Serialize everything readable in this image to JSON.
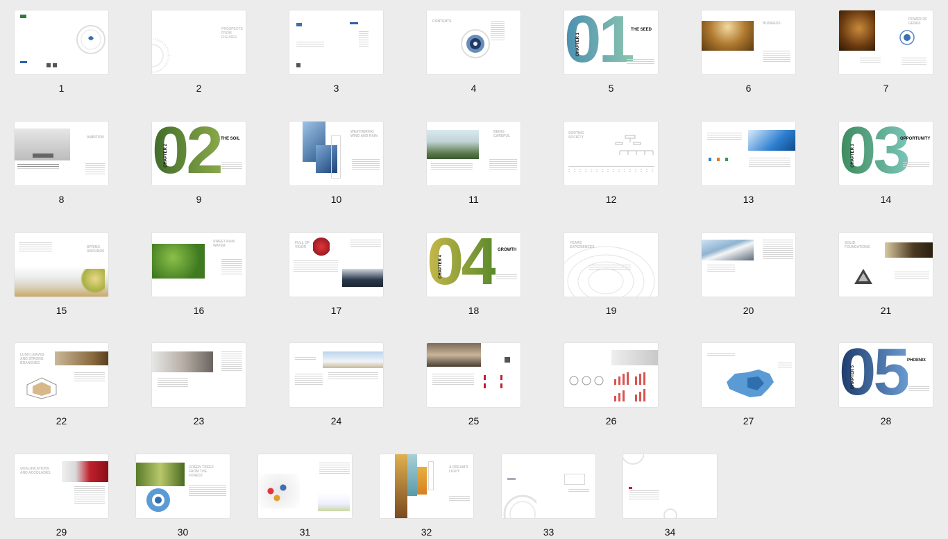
{
  "pages": [
    {
      "n": "1"
    },
    {
      "n": "2",
      "title": "PROSPECTS FROM FIGURES"
    },
    {
      "n": "3"
    },
    {
      "n": "4",
      "title": "CONTENTS"
    },
    {
      "n": "5",
      "chapter": "CHAPTER 1",
      "title": "THE SEED",
      "big": "01"
    },
    {
      "n": "6",
      "title": "BUSINESS"
    },
    {
      "n": "7",
      "title": "POWER OF GENES"
    },
    {
      "n": "8",
      "title": "AMBITION"
    },
    {
      "n": "9",
      "chapter": "CHAPTER 2",
      "title": "THE SOIL",
      "big": "02"
    },
    {
      "n": "10",
      "title": "WEATHERING WIND AND RAIN"
    },
    {
      "n": "11",
      "title": "BEING CAREFUL"
    },
    {
      "n": "12",
      "title": "SORTING SOCIETY"
    },
    {
      "n": "13"
    },
    {
      "n": "14",
      "chapter": "CHAPTER 3",
      "title": "OPPORTUNITY",
      "big": "03"
    },
    {
      "n": "15",
      "title": "SPRING ABOUNDS"
    },
    {
      "n": "16",
      "title": "SWEET RAIN WATER"
    },
    {
      "n": "17",
      "title": "FULL OF VIGOR"
    },
    {
      "n": "18",
      "chapter": "CHAPTER 4",
      "title": "GROWTH",
      "big": "04"
    },
    {
      "n": "19",
      "title": "YEARS EXPERIENCES"
    },
    {
      "n": "20"
    },
    {
      "n": "21",
      "title": "SOLID FOUNDATIONS"
    },
    {
      "n": "22",
      "title": "LUSH LEAVES AND STRONG BRANCHES"
    },
    {
      "n": "23"
    },
    {
      "n": "24"
    },
    {
      "n": "25"
    },
    {
      "n": "26"
    },
    {
      "n": "27"
    },
    {
      "n": "28",
      "chapter": "CHAPTER 5",
      "title": "PHOENIX",
      "big": "05"
    },
    {
      "n": "29",
      "title": "QUALIFICATIONS AND ACCOLADES"
    },
    {
      "n": "30",
      "title": "GREEN TREES FROM THE FOREST"
    },
    {
      "n": "31"
    },
    {
      "n": "32",
      "title": "A DREAM'S LIGHT"
    },
    {
      "n": "33"
    },
    {
      "n": "34"
    }
  ]
}
